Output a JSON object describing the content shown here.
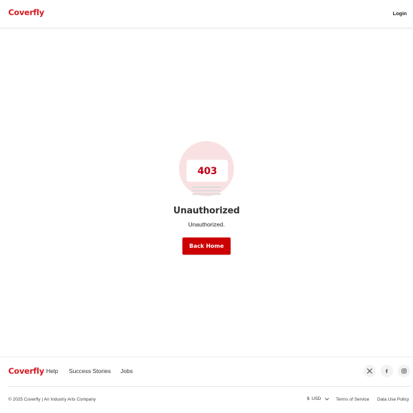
{
  "header": {
    "logo": "Coverfly",
    "login_label": "Login"
  },
  "error": {
    "code": "403",
    "title": "Unauthorized",
    "message": "Unauthorized.",
    "back_label": "Back Home"
  },
  "footer": {
    "logo": "Coverfly",
    "nav": {
      "help": "Help",
      "success_stories": "Success Stories",
      "jobs": "Jobs"
    },
    "social_icons": [
      "x-icon",
      "facebook-icon",
      "instagram-icon"
    ],
    "copyright": "© 2025 Coverfly | An Industry Arts Company",
    "currency": {
      "symbol": "$",
      "code": "USD"
    },
    "links": {
      "terms": "Terms of Service",
      "data_policy": "Data Use Policy"
    }
  },
  "colors": {
    "brand_red": "#d71920",
    "button_red": "#cc0000",
    "illustration_pink": "#f9e1e2"
  }
}
